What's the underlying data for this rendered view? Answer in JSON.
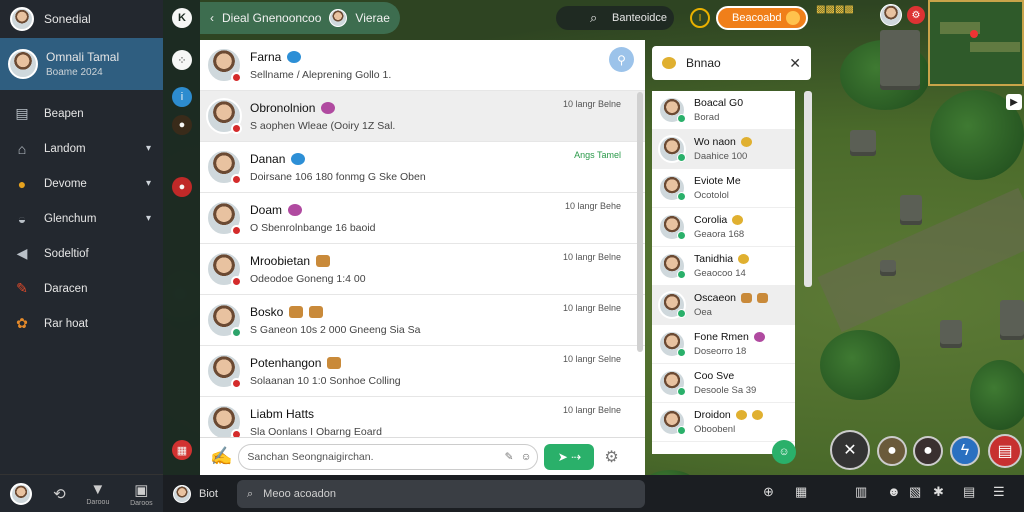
{
  "sidebar": {
    "app_title": "Sonedial",
    "user": {
      "name": "Omnali Tamal",
      "status": "Boame 2024"
    },
    "items": [
      {
        "label": "Beapen",
        "icon": "clipboard-icon",
        "chevron": false
      },
      {
        "label": "Landom",
        "icon": "home-icon",
        "chevron": true
      },
      {
        "label": "Devome",
        "icon": "palette-icon",
        "chevron": true
      },
      {
        "label": "Glenchum",
        "icon": "gamepad-icon",
        "chevron": true
      },
      {
        "label": "Sodeltiof",
        "icon": "megaphone-icon",
        "chevron": false
      },
      {
        "label": "Daracen",
        "icon": "pencil-icon",
        "chevron": false
      },
      {
        "label": "Rar hoat",
        "icon": "paw-icon",
        "chevron": false
      }
    ],
    "bottom": [
      {
        "label": "",
        "icon": "user-avatar"
      },
      {
        "label": "",
        "icon": "refresh-icon"
      },
      {
        "label": "Daroou",
        "icon": "shirt-icon"
      },
      {
        "label": "Daroos",
        "icon": "robot-icon"
      }
    ]
  },
  "chat": {
    "header_title": "Dieal Gnenooncoo",
    "header_user": "Vierae",
    "composer_placeholder": "Sanchan Seongnaigirchan.",
    "rows": [
      {
        "name": "Farna",
        "emoji": "b",
        "preview": "Sellname / Aleprening Gollo 1.",
        "time": "",
        "badge": "r",
        "selected": false
      },
      {
        "name": "Obronolnion",
        "emoji": "p",
        "preview": "S aophen Wleae (Ooiry 1Z Sal.",
        "time": "10 langr Belne",
        "badge": "r",
        "selected": true
      },
      {
        "name": "Danan",
        "emoji": "b",
        "preview": "Doirsane 106 180 fonmg G Ske Oben",
        "time": "Angs Tamel",
        "time_green": true,
        "badge": "r",
        "selected": false
      },
      {
        "name": "Doam",
        "emoji": "p",
        "preview": "O Sbenrolnbange 16 baoid",
        "time": "10 langr Behe",
        "badge": "r",
        "selected": false
      },
      {
        "name": "Mroobietan",
        "emoji": "o",
        "preview": "Odeodoe Goneng 1:4 00",
        "time": "10 langr Belne",
        "badge": "r",
        "selected": false
      },
      {
        "name": "Bosko",
        "emoji": "oo",
        "preview": "S Ganeon 10s 2 000 Gneeng Sia Sa",
        "time": "10 langr Belne",
        "badge": "g",
        "selected": false
      },
      {
        "name": "Potenhangon",
        "emoji": "o",
        "preview": "Solaanan 10 1:0 Sonhoe Colling",
        "time": "10 langr Selne",
        "badge": "r",
        "selected": false
      },
      {
        "name": "Liabm Hatts",
        "emoji": "",
        "preview": "Sla Oonlans I Obarng Eoard",
        "time": "10 langr Belne",
        "badge": "r",
        "selected": false
      }
    ]
  },
  "topbar": {
    "search_label": "Banteoidce",
    "action_label": "Beacoabd"
  },
  "members": {
    "title": "Bnnao",
    "rows": [
      {
        "name": "Boacal G0",
        "status": "Borad",
        "emoji": "",
        "selected": false
      },
      {
        "name": "Wo naon",
        "status": "Daahice 100",
        "emoji": "y",
        "selected": true
      },
      {
        "name": "Eviote Me",
        "status": "Ocotolol",
        "emoji": "",
        "selected": false
      },
      {
        "name": "Corolia",
        "status": "Geaora 168",
        "emoji": "y",
        "selected": false
      },
      {
        "name": "Tanidhia",
        "status": "Geaocoo 14",
        "emoji": "y",
        "selected": false
      },
      {
        "name": "Oscaeon",
        "status": "Oea",
        "emoji": "oo",
        "selected": true
      },
      {
        "name": "Fone Rmen",
        "status": "Doseorro 18",
        "emoji": "p",
        "selected": false
      },
      {
        "name": "Coo Sve",
        "status": "Desoole Sa 39",
        "emoji": "",
        "selected": false
      },
      {
        "name": "Droidon",
        "status": "Oboobenl",
        "emoji": "yy",
        "selected": false
      }
    ]
  },
  "bottombar": {
    "user_label": "Biot",
    "search_placeholder": "Meoo acoadon"
  },
  "colors": {
    "sidebar_bg": "#23282f",
    "sidebar_selected": "#2f5e80",
    "chat_header": "#3d6d4f",
    "accent_green": "#2ab06a",
    "accent_orange": "#f07f1a",
    "badge_red": "#d42b2b"
  }
}
